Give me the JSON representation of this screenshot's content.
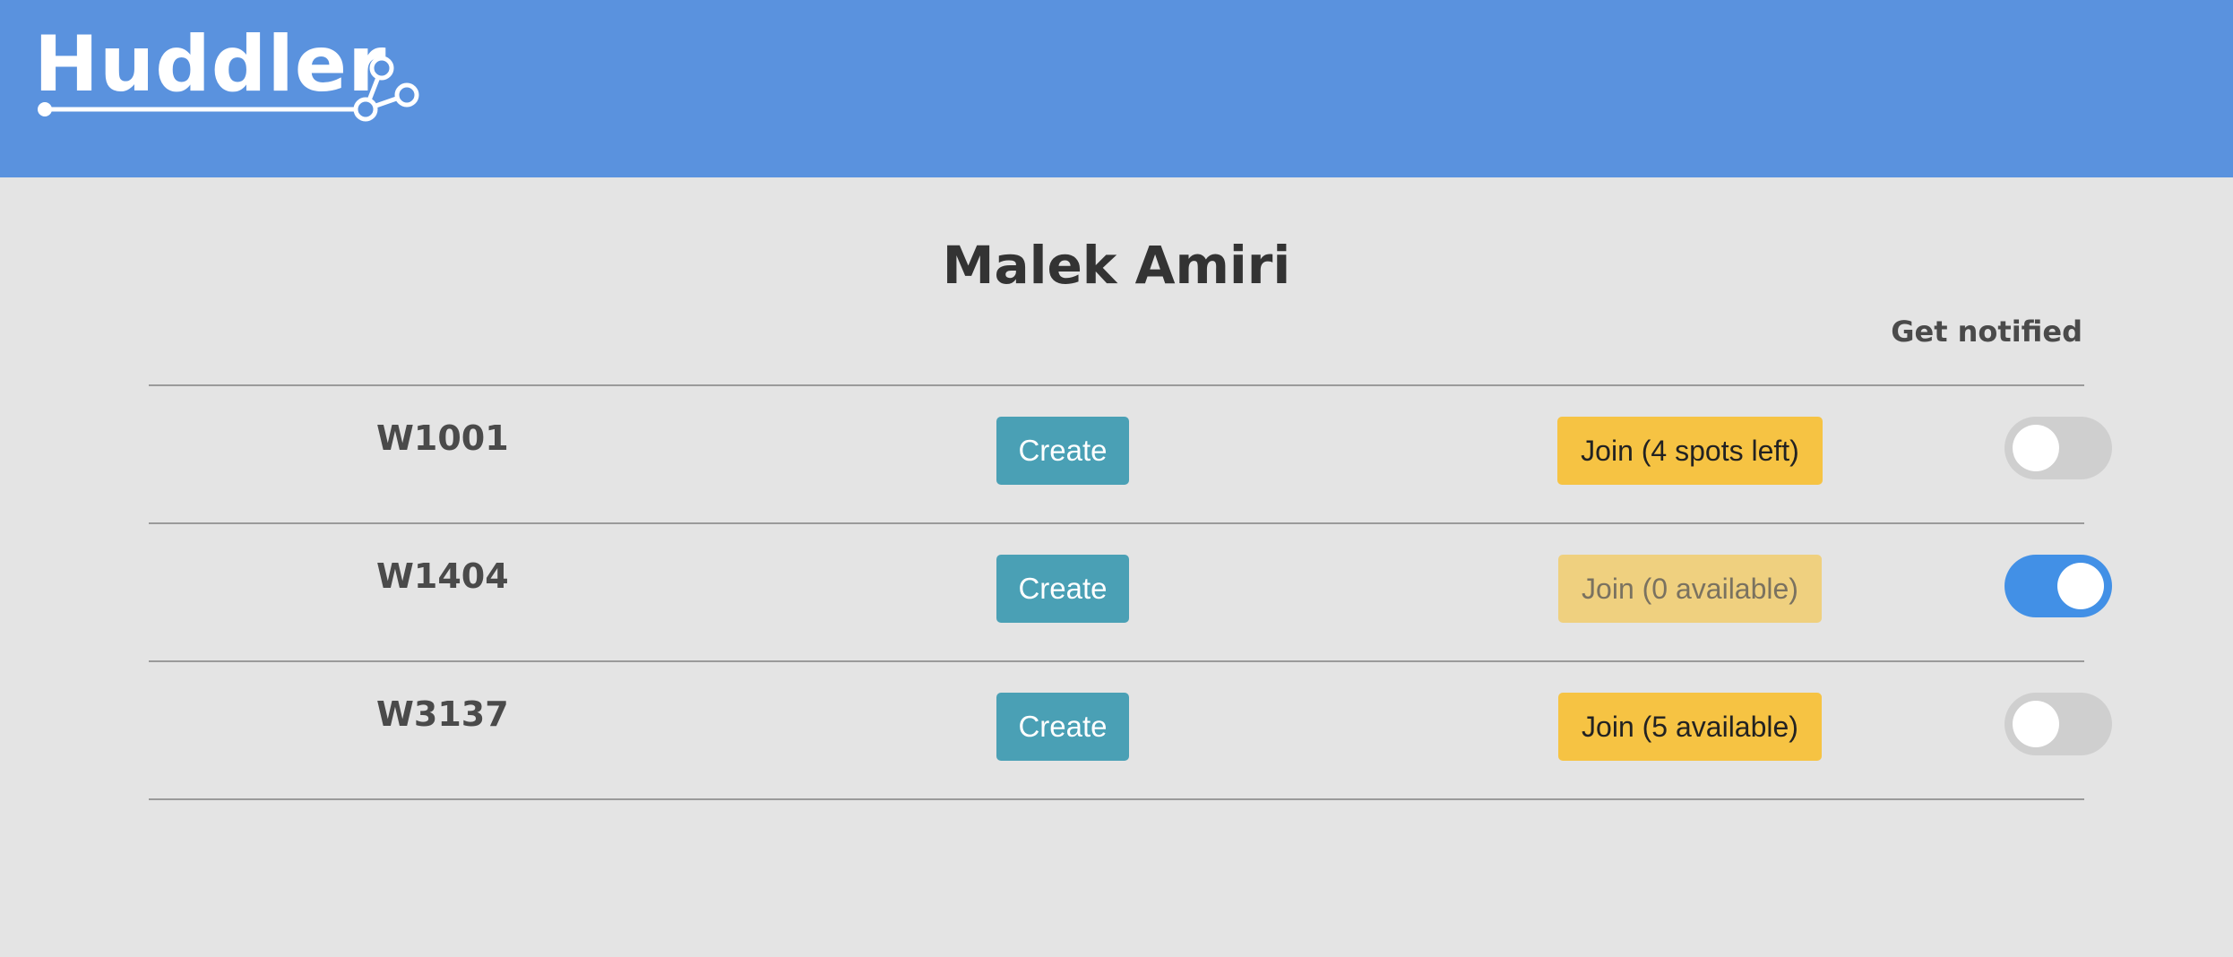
{
  "app": {
    "logo_text": "Huddler"
  },
  "page": {
    "title": "Malek Amiri",
    "notify_header": "Get notified"
  },
  "courses": [
    {
      "code": "W1001",
      "create_label": "Create",
      "join_label": "Join (4 spots left)",
      "join_enabled": true,
      "notify": false
    },
    {
      "code": "W1404",
      "create_label": "Create",
      "join_label": "Join (0 available)",
      "join_enabled": false,
      "notify": true
    },
    {
      "code": "W3137",
      "create_label": "Create",
      "join_label": "Join (5 available)",
      "join_enabled": true,
      "notify": false
    }
  ],
  "colors": {
    "header": "#5a92de",
    "background": "#e4e4e4",
    "create_button": "#4aa0b5",
    "join_button": "#f6c343",
    "join_button_disabled": "#efd07f",
    "toggle_on": "#4290e6",
    "toggle_off": "#cfcfcf"
  }
}
